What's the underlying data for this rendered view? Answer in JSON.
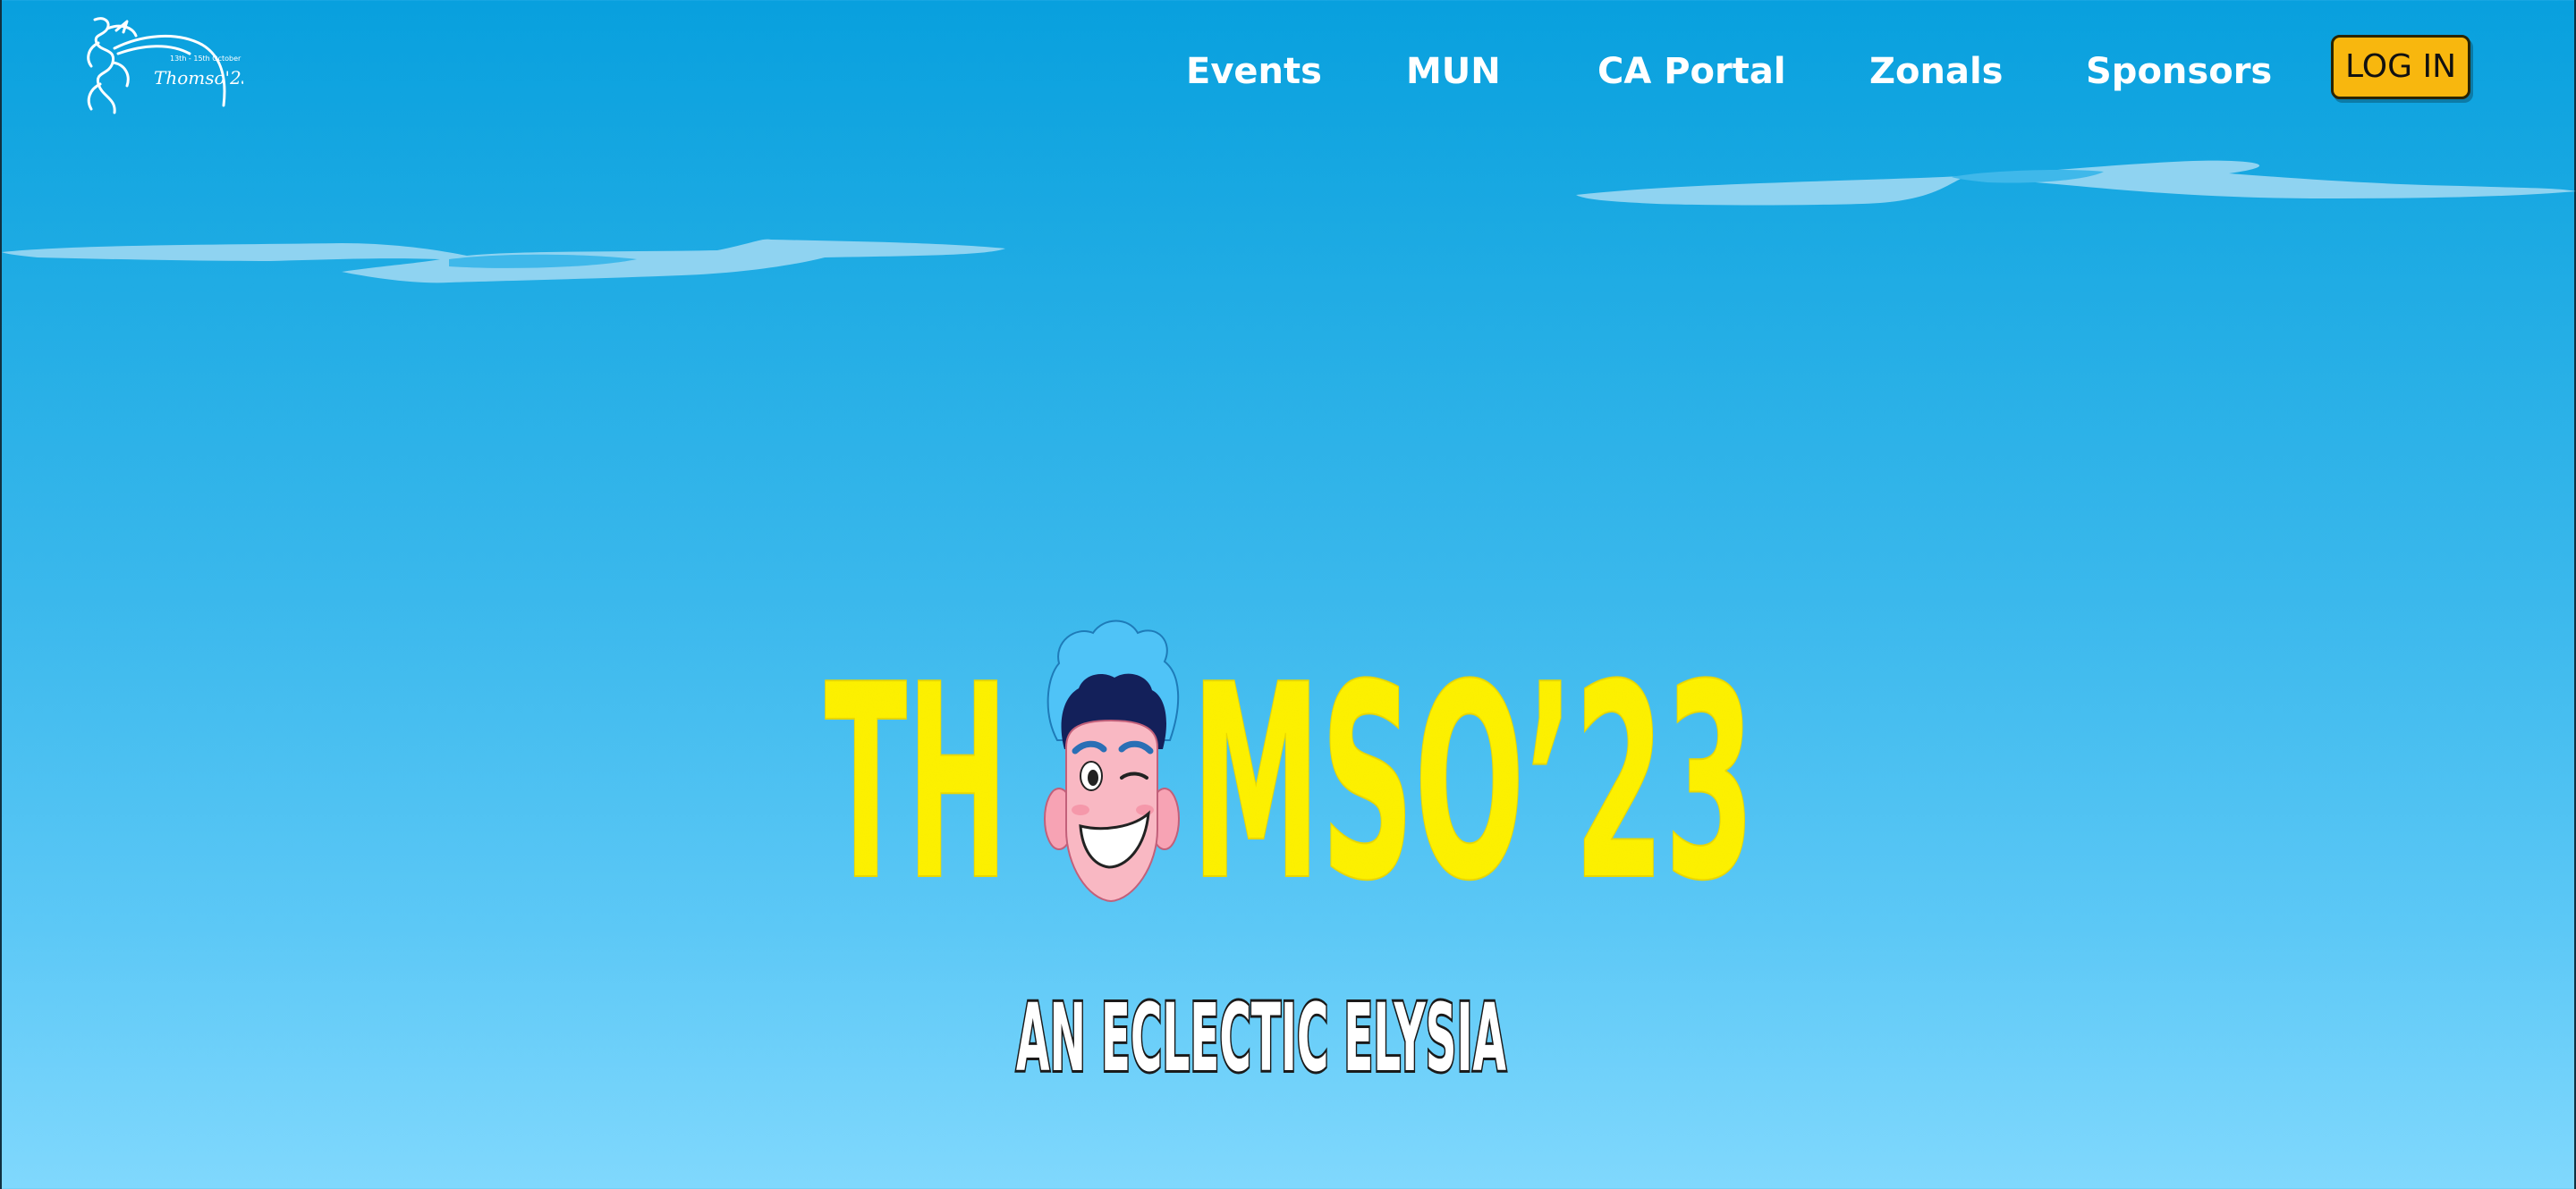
{
  "brand": {
    "logo_text": "Thomso'23",
    "logo_dates": "13th - 15th October"
  },
  "nav": {
    "items": [
      {
        "label": "Events"
      },
      {
        "label": "MUN"
      },
      {
        "label": "CA Portal"
      },
      {
        "label": "Zonals"
      },
      {
        "label": "Sponsors"
      }
    ],
    "login_label": "LOG IN"
  },
  "hero": {
    "title_left": "TH",
    "title_right": "MSO’23",
    "tagline": "AN ECLECTIC ELYSIA"
  },
  "colors": {
    "sky_top": "#08a0de",
    "sky_bottom": "#80d8fd",
    "title_yellow": "#fff200",
    "login_bg": "#f8b70e",
    "cloud": "#8fd3f1"
  }
}
